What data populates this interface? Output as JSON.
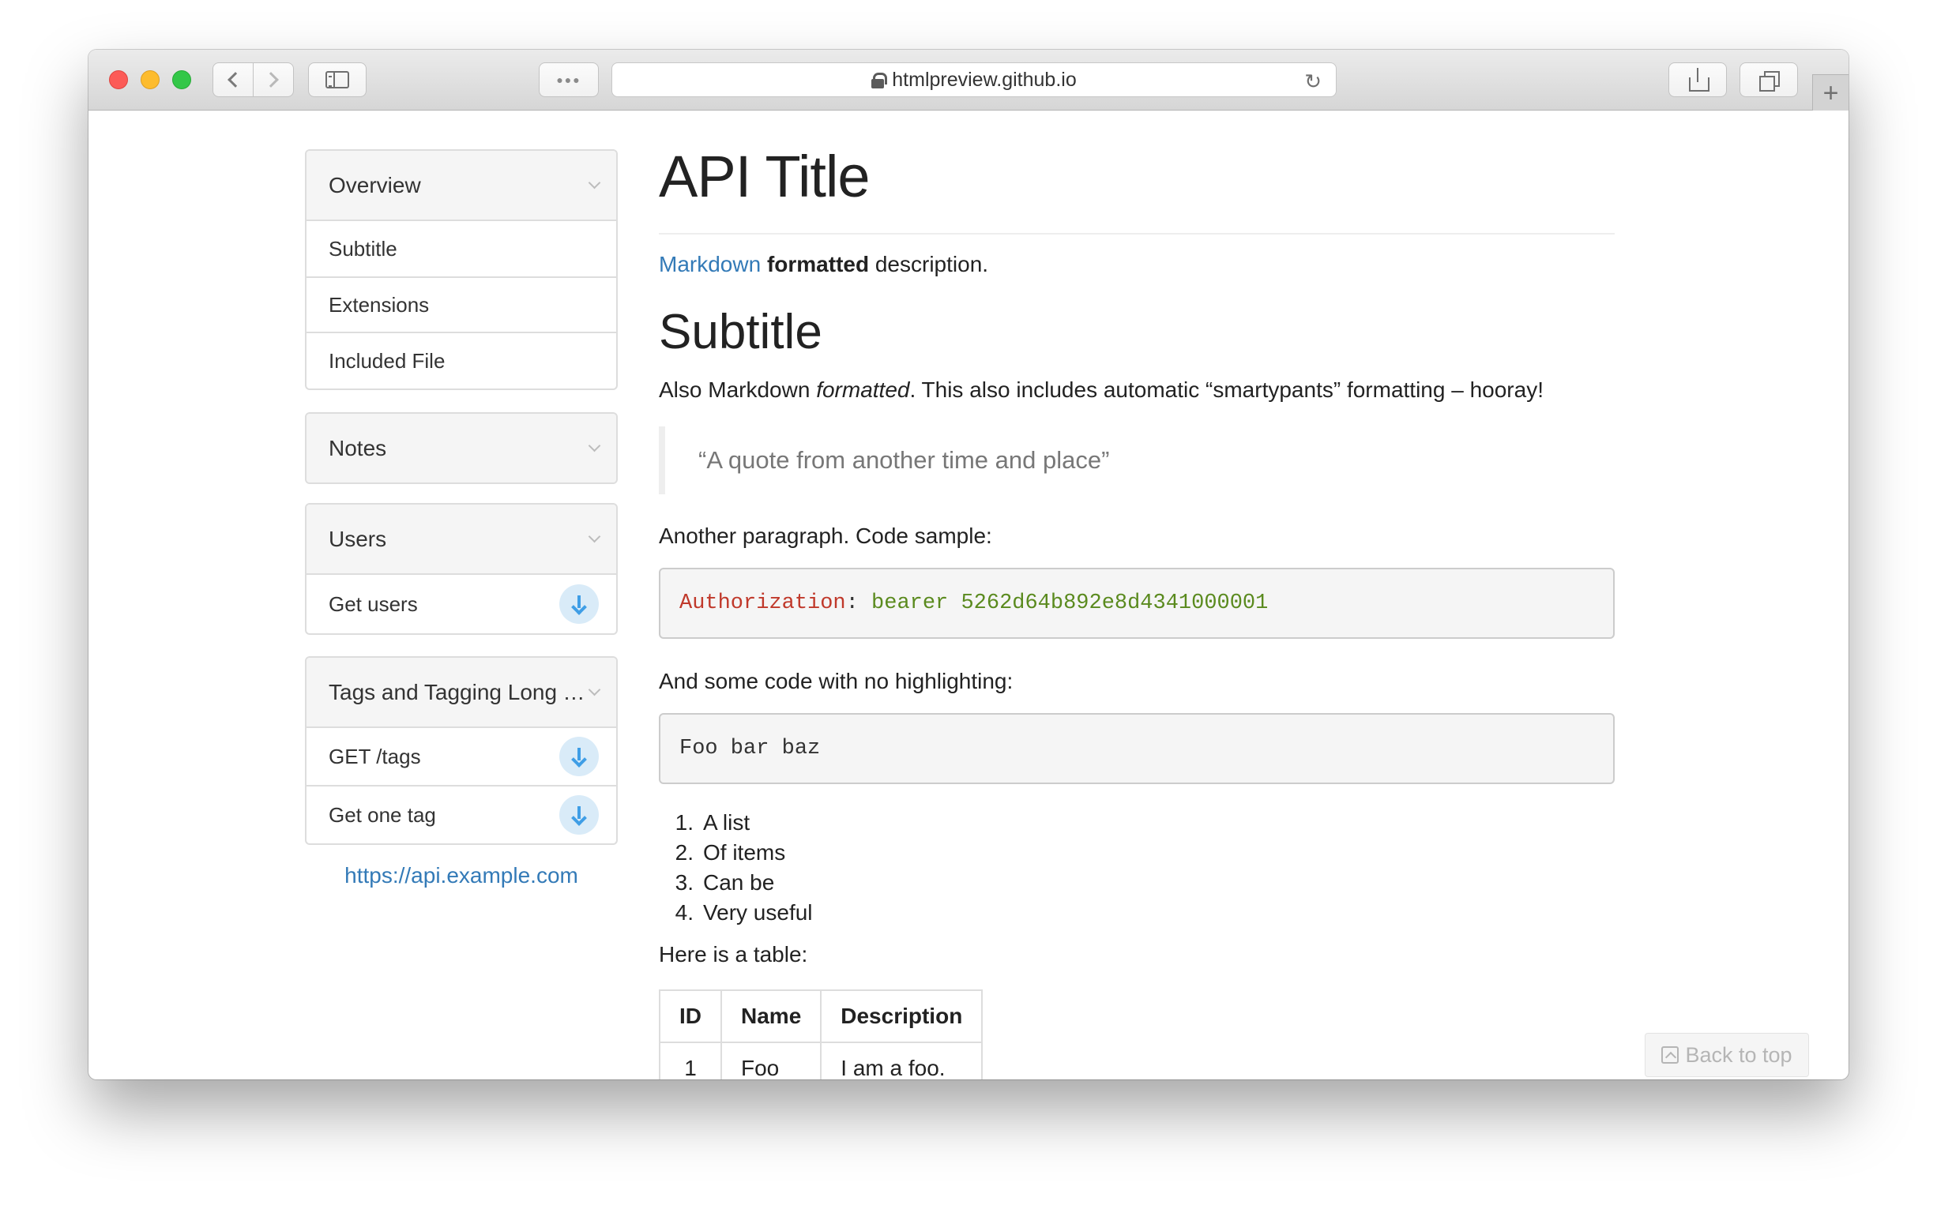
{
  "browser": {
    "url": "htmlpreview.github.io",
    "reload_icon": "↻",
    "new_tab_icon": "+"
  },
  "sidebar": {
    "panels": [
      {
        "title": "Overview",
        "items": [
          {
            "label": "Subtitle"
          },
          {
            "label": "Extensions"
          },
          {
            "label": "Included File"
          }
        ]
      },
      {
        "title": "Notes",
        "items": []
      },
      {
        "title": "Users",
        "items": [
          {
            "label": "Get users",
            "download": true
          }
        ]
      },
      {
        "title": "Tags and Tagging Long Title",
        "items": [
          {
            "label": "GET /tags",
            "download": true
          },
          {
            "label": "Get one tag",
            "download": true
          }
        ]
      }
    ],
    "host_link": "https://api.example.com"
  },
  "main": {
    "title": "API Title",
    "description": {
      "link": "Markdown",
      "bold": "formatted",
      "rest": " description."
    },
    "subtitle": "Subtitle",
    "para1": {
      "a": "Also Markdown ",
      "em": "formatted",
      "b": ". This also includes automatic “smartypants” formatting – hooray!"
    },
    "quote": "“A quote from another time and place”",
    "para2": "Another paragraph. Code sample:",
    "code1": {
      "key": "Authorization",
      "colon": ": ",
      "value": "bearer 5262d64b892e8d4341000001"
    },
    "para3": "And some code with no highlighting:",
    "code2": "Foo bar baz",
    "list": [
      "A list",
      "Of items",
      "Can be",
      "Very useful"
    ],
    "para4": "Here is a table:",
    "table": {
      "headers": [
        "ID",
        "Name",
        "Description"
      ],
      "rows": [
        [
          "1",
          "Foo",
          "I am a foo."
        ]
      ]
    },
    "back_to_top": "Back to top"
  }
}
